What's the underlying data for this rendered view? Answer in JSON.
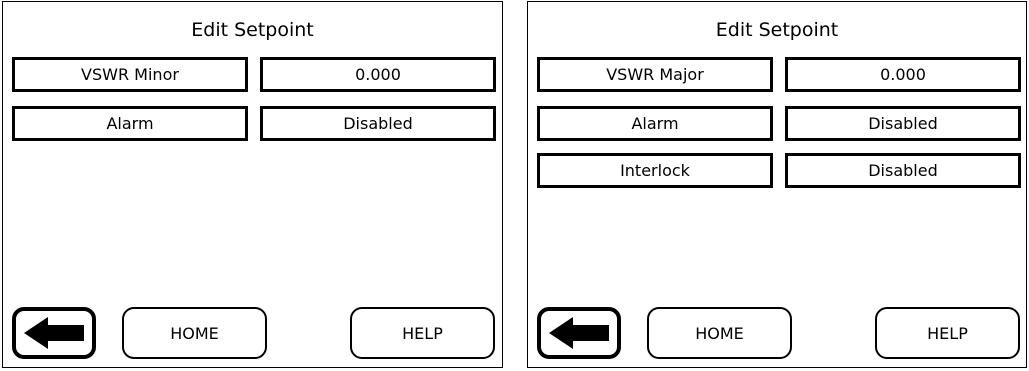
{
  "panels": [
    {
      "title": "Edit Setpoint",
      "rows": [
        {
          "name": "VSWR Minor",
          "value": "0.000"
        },
        {
          "name": "Alarm",
          "value": "Disabled"
        }
      ],
      "buttons": {
        "back_icon": "back-arrow-icon",
        "home": "HOME",
        "help": "HELP"
      }
    },
    {
      "title": "Edit Setpoint",
      "rows": [
        {
          "name": "VSWR Major",
          "value": "0.000"
        },
        {
          "name": "Alarm",
          "value": "Disabled"
        },
        {
          "name": "Interlock",
          "value": "Disabled"
        }
      ],
      "buttons": {
        "back_icon": "back-arrow-icon",
        "home": "HOME",
        "help": "HELP"
      }
    }
  ]
}
